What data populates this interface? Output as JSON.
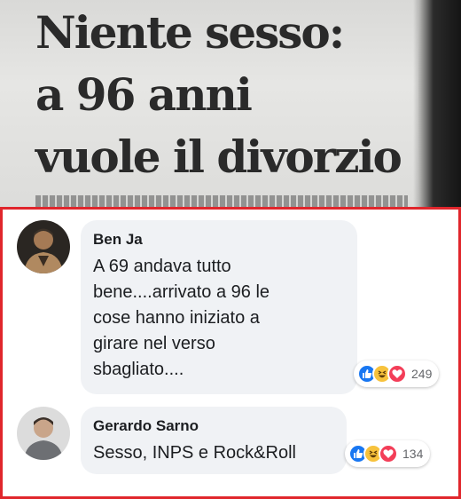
{
  "clipping": {
    "headline": [
      "Niente sesso:",
      "a 96 anni",
      "vuole il divorzio"
    ]
  },
  "comments": [
    {
      "author": "Ben Ja",
      "lines": [
        "A 69 andava tutto",
        "bene....arrivato a 96 le",
        "cose hanno iniziato a",
        "girare nel verso",
        "sbagliato...."
      ],
      "reaction_count": "249",
      "reactions": [
        "like",
        "haha",
        "love"
      ]
    },
    {
      "author": "Gerardo Sarno",
      "lines": [
        "Sesso, INPS e Rock&Roll"
      ],
      "reaction_count": "134",
      "reactions": [
        "like",
        "haha",
        "love"
      ]
    }
  ],
  "colors": {
    "frame": "#e0262c",
    "bubble": "#f0f2f5",
    "like": "#1877f2",
    "haha": "#f7c23c",
    "love": "#f33e58"
  }
}
